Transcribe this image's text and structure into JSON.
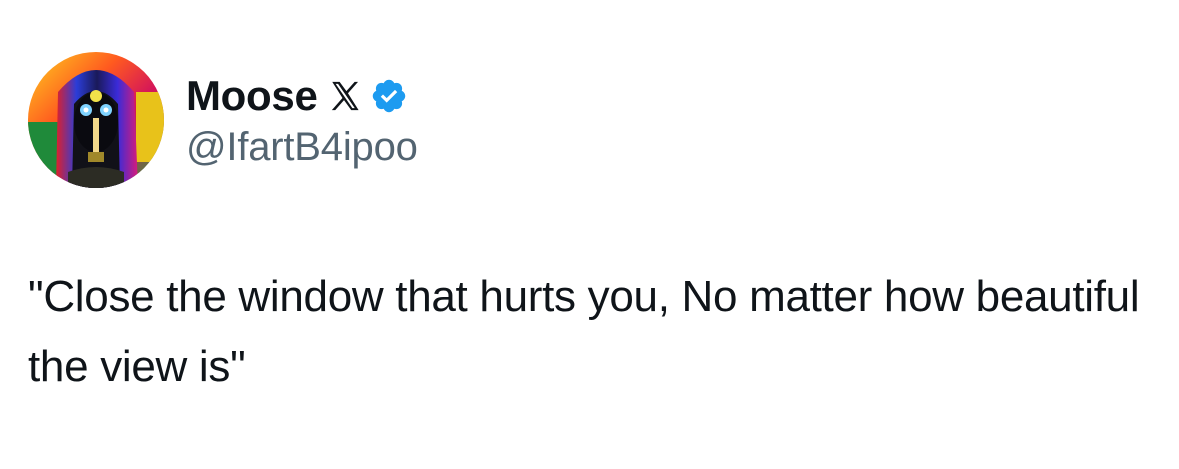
{
  "author": {
    "display_name": "Moose",
    "handle": "@IfartB4ipoo",
    "verified": true,
    "badge_icon": "x-logo-icon",
    "verified_color": "#1d9bf0"
  },
  "tweet": {
    "text": "\"Close the window that hurts you, No matter how beautiful the view is\""
  },
  "colors": {
    "text": "#0f1419",
    "secondary": "#536471",
    "background": "#ffffff"
  }
}
